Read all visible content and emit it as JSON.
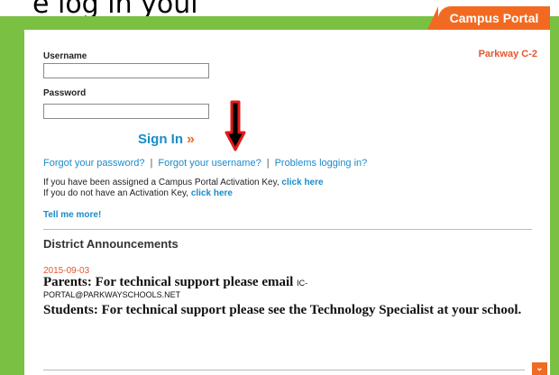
{
  "caption": "e log in youl",
  "tab": {
    "label": "Campus Portal"
  },
  "district": "Parkway C-2",
  "login": {
    "username_label": "Username",
    "password_label": "Password",
    "username_value": "",
    "password_value": "",
    "signin_label": "Sign In",
    "signin_chevron": "»"
  },
  "links": {
    "forgot_password": "Forgot your password?",
    "forgot_username": "Forgot your username?",
    "problems": "Problems logging in?",
    "separator": "|"
  },
  "activation": {
    "line1_text": "If you have been assigned a Campus Portal Activation Key,",
    "line1_link": "click here",
    "line2_text": "If you do not have an Activation Key,",
    "line2_link": "click here",
    "tell_more": "Tell me more!"
  },
  "announcements": {
    "heading": "District Announcements",
    "date": "2015-09-03",
    "parents_text": "Parents:  For technical support please email",
    "parents_email_a": "IC-",
    "parents_email_b": "PORTAL@PARKWAYSCHOOLS.NET",
    "students_text": "Students: For technical support please see the Technology Specialist at your school."
  },
  "expand_icon": "chevron-down-icon",
  "colors": {
    "green": "#7ac143",
    "orange": "#f26a22",
    "link": "#1a8bc9",
    "red_arrow": "#e21b1b"
  }
}
